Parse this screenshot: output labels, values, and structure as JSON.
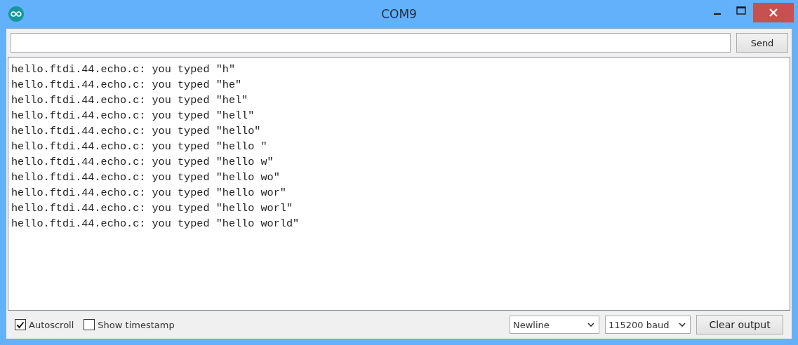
{
  "window": {
    "title": "COM9"
  },
  "send_button": {
    "label": "Send"
  },
  "output": {
    "lines": [
      "hello.ftdi.44.echo.c: you typed \"h\"",
      "hello.ftdi.44.echo.c: you typed \"he\"",
      "hello.ftdi.44.echo.c: you typed \"hel\"",
      "hello.ftdi.44.echo.c: you typed \"hell\"",
      "hello.ftdi.44.echo.c: you typed \"hello\"",
      "hello.ftdi.44.echo.c: you typed \"hello \"",
      "hello.ftdi.44.echo.c: you typed \"hello w\"",
      "hello.ftdi.44.echo.c: you typed \"hello wo\"",
      "hello.ftdi.44.echo.c: you typed \"hello wor\"",
      "hello.ftdi.44.echo.c: you typed \"hello worl\"",
      "hello.ftdi.44.echo.c: you typed \"hello world\""
    ]
  },
  "options": [
    {
      "label": "Autoscroll",
      "checked": true
    },
    {
      "label": "Show timestamp",
      "checked": false
    }
  ],
  "line_ending": {
    "value": "Newline"
  },
  "baud_rate": {
    "value": "115200 baud"
  },
  "clear_button": {
    "label": "Clear output"
  }
}
